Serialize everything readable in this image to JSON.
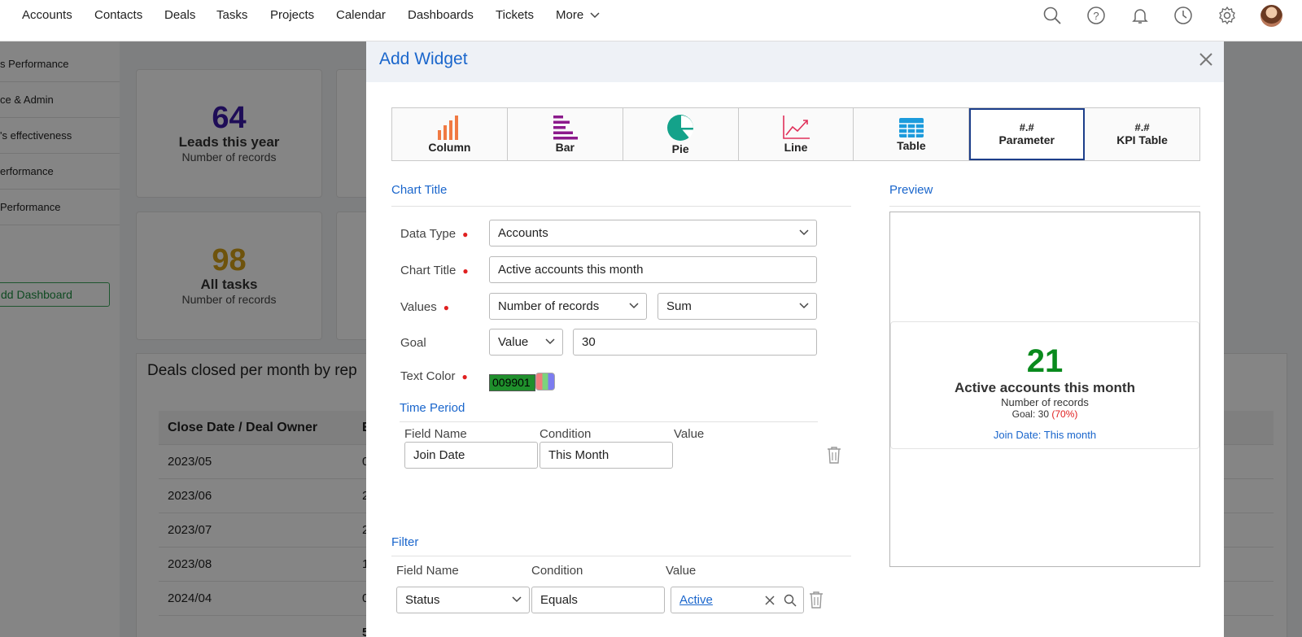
{
  "nav": {
    "items": [
      "Accounts",
      "Contacts",
      "Deals",
      "Tasks",
      "Projects",
      "Calendar",
      "Dashboards",
      "Tickets"
    ],
    "more_label": "More",
    "icons": [
      "search-icon",
      "help-icon",
      "bell-icon",
      "clock-icon",
      "gear-icon"
    ]
  },
  "sidebar": {
    "items": [
      "s Performance",
      "ce & Admin",
      "'s effectiveness",
      "erformance",
      "Performance"
    ],
    "add_dashboard": "dd Dashboard"
  },
  "cards": [
    {
      "value": "64",
      "label": "Leads this year",
      "sub": "Number of records",
      "color": "#3b1aa8"
    },
    {
      "value": "98",
      "label": "All tasks",
      "sub": "Number of records",
      "color": "#d4a017"
    }
  ],
  "deals": {
    "title": "Deals closed per month by rep",
    "header": [
      "Close Date / Deal Owner",
      "E"
    ],
    "rows": [
      [
        "2023/05",
        "0"
      ],
      [
        "2023/06",
        "2"
      ],
      [
        "2023/07",
        "2"
      ],
      [
        "2023/08",
        "1"
      ],
      [
        "2024/04",
        "0"
      ],
      [
        "",
        "5"
      ]
    ]
  },
  "modal": {
    "title": "Add Widget",
    "tabs": [
      {
        "label": "Column",
        "icon": "column-chart-icon"
      },
      {
        "label": "Bar",
        "icon": "bar-chart-icon"
      },
      {
        "label": "Pie",
        "icon": "pie-chart-icon"
      },
      {
        "label": "Line",
        "icon": "line-chart-icon"
      },
      {
        "label": "Table",
        "icon": "table-icon"
      },
      {
        "label": "Parameter",
        "hash": "#.#"
      },
      {
        "label": "KPI Table",
        "hash": "#.#"
      }
    ],
    "chart_title_section": "Chart Title",
    "preview_section": "Preview",
    "data_type": {
      "label": "Data Type",
      "value": "Accounts"
    },
    "chart_title": {
      "label": "Chart Title",
      "value": "Active accounts this month"
    },
    "values": {
      "label": "Values",
      "metric": "Number of records",
      "aggregate": "Sum"
    },
    "goal": {
      "label": "Goal",
      "type": "Value",
      "value": "30"
    },
    "text_color": {
      "label": "Text Color",
      "value": "009901"
    },
    "time_period": {
      "section": "Time Period",
      "headers": [
        "Field Name",
        "Condition",
        "Value"
      ],
      "field": "Join Date",
      "condition": "This Month"
    },
    "filter": {
      "section": "Filter",
      "headers": [
        "Field Name",
        "Condition",
        "Value"
      ],
      "field": "Status",
      "condition": "Equals",
      "value": "Active"
    },
    "preview": {
      "value": "21",
      "label": "Active accounts this month",
      "sub": "Number of records",
      "goal_text": "Goal: 30",
      "goal_pct": "(70%)",
      "period": "Join Date: This month",
      "color": "#098a1d"
    }
  }
}
